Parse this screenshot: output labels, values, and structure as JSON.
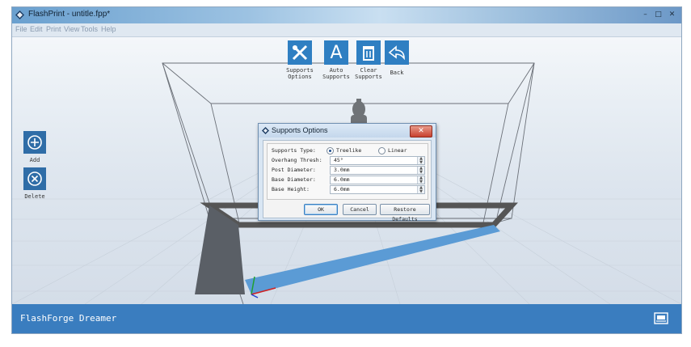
{
  "window": {
    "title": "FlashPrint - untitle.fpp*",
    "buttons": [
      "–",
      "□",
      "✕"
    ]
  },
  "menu": [
    "File",
    "Edit",
    "Print",
    "View",
    "Tools",
    "Help"
  ],
  "toolbar": {
    "supports_options": "Supports\nOptions",
    "auto_supports": "Auto\nSupports",
    "clear_supports": "Clear\nSupports",
    "back": "Back"
  },
  "sidebar": {
    "add": "Add",
    "delete": "Delete"
  },
  "dialog": {
    "title": "Supports Options",
    "close": "✕",
    "supports_type_label": "Supports Type:",
    "treelike": "Treelike",
    "linear": "Linear",
    "selected_type": "Treelike",
    "overhang_label": "Overhang Thresh:",
    "overhang_value": "45°",
    "post_diameter_label": "Post Diameter:",
    "post_diameter_value": "3.0mm",
    "base_diameter_label": "Base Diameter:",
    "base_diameter_value": "6.0mm",
    "base_height_label": "Base Height:",
    "base_height_value": "6.0mm",
    "ok": "OK",
    "cancel": "Cancel",
    "restore": "Restore Defaults"
  },
  "status": {
    "printer": "FlashForge Dreamer"
  },
  "colors": {
    "accent": "#2f7fc2",
    "statusbar": "#3a7dbf",
    "build_plate_edge": "#555555",
    "build_plate_front": "#5b9bd5"
  }
}
